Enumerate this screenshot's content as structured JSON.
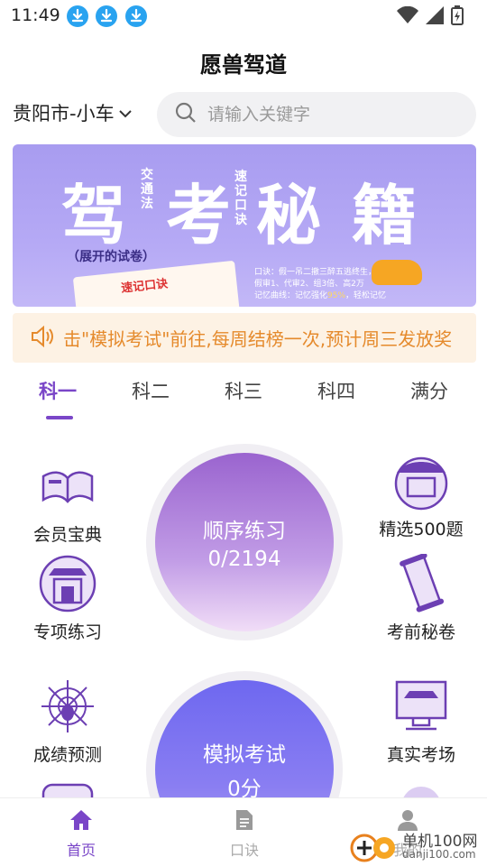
{
  "status_bar": {
    "time": "11:49"
  },
  "header": {
    "title": "愿兽驾道"
  },
  "location": {
    "city": "贵阳市-小车"
  },
  "search": {
    "placeholder": "请输入关键字"
  },
  "banner": {
    "big1": "驾",
    "big2": "考",
    "big3": "秘",
    "big4": "籍",
    "small_left": "交\n通\n法",
    "small_right": "速\n记\n口\n诀",
    "sub": "（展开的试卷）",
    "paper_label": "速记口诀",
    "note_line1": "口诀：假一吊二撤三醉五逃终生，",
    "note_line2": "假审1、代审2、组3倍、高2万",
    "note_line3_prefix": "记忆曲线：记忆强化",
    "note_line3_highlight": "95%",
    "note_line3_suffix": "，轻松记忆"
  },
  "notice": {
    "text": "击\"模拟考试\"前往,每周结榜一次,预计周三发放奖"
  },
  "tabs": [
    {
      "label": "科一",
      "active": true
    },
    {
      "label": "科二",
      "active": false
    },
    {
      "label": "科三",
      "active": false
    },
    {
      "label": "科四",
      "active": false
    },
    {
      "label": "满分",
      "active": false
    }
  ],
  "features": {
    "vip": "会员宝典",
    "special": "专项练习",
    "selected": "精选500题",
    "secret": "考前秘卷",
    "predict": "成绩预测",
    "real": "真实考场"
  },
  "practice": {
    "title": "顺序练习",
    "progress": "0/2194"
  },
  "exam": {
    "title": "模拟考试",
    "score": "0分"
  },
  "nav": [
    {
      "label": "首页",
      "active": true
    },
    {
      "label": "口诀",
      "active": false
    },
    {
      "label": "我的",
      "active": false
    }
  ],
  "watermark": {
    "text": "单机100网",
    "sub": "danji100.com"
  },
  "colors": {
    "accent": "#7a46c8",
    "notice": "#e58a2c",
    "banner": "#b0a4f3"
  }
}
